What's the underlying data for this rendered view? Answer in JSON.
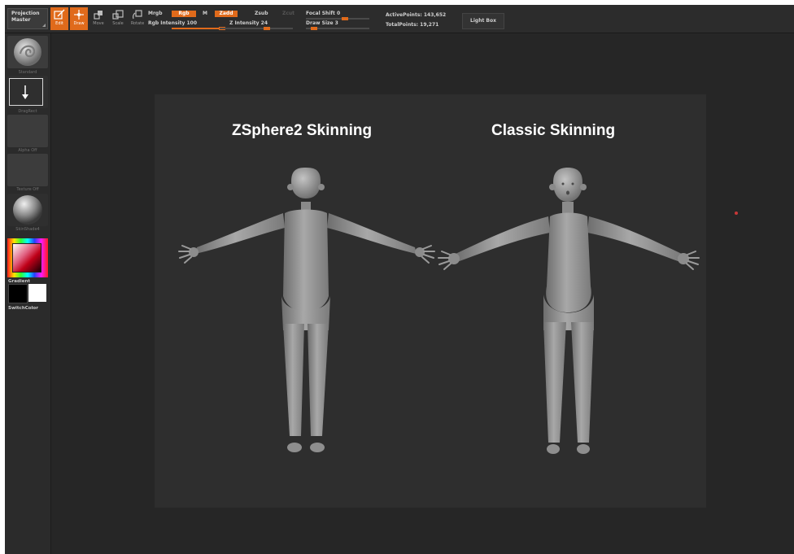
{
  "toolbar": {
    "projection_master": [
      "Projection",
      "Master"
    ],
    "tools": [
      {
        "label": "Edit",
        "icon": "edit-icon",
        "active": true
      },
      {
        "label": "Draw",
        "icon": "draw-icon",
        "active": true
      },
      {
        "label": "Move",
        "icon": "move-icon",
        "active": false
      },
      {
        "label": "Scale",
        "icon": "scale-icon",
        "active": false
      },
      {
        "label": "Rotate",
        "icon": "rotate-icon",
        "active": false
      }
    ],
    "mrgb": "Mrgb",
    "rgb": "Rgb",
    "m": "M",
    "rgb_intensity": "Rgb Intensity 100",
    "zadd": "Zadd",
    "zsub": "Zsub",
    "zcut": "Zcut",
    "z_intensity": "Z Intensity 24",
    "focal_shift": "Focal Shift 0",
    "draw_size": "Draw Size 3",
    "active_points": "ActivePoints: 143,652",
    "total_points": "TotalPoints: 19,271",
    "light_box": "Light Box"
  },
  "shelf": {
    "brush_label": "Standard",
    "stroke_label": "DragRect",
    "alpha_label": "Alpha Off",
    "texture_label": "Texture Off",
    "material_label": "SkinShade4",
    "gradient_label": "Gradient",
    "switch_label": "SwitchColor"
  },
  "canvas": {
    "left_title": "ZSphere2 Skinning",
    "right_title": "Classic Skinning"
  },
  "colors": {
    "accent": "#e06a1b",
    "ui_background": "#262626",
    "canvas_background": "#2e2e2e",
    "model": "#9a9a9a"
  }
}
